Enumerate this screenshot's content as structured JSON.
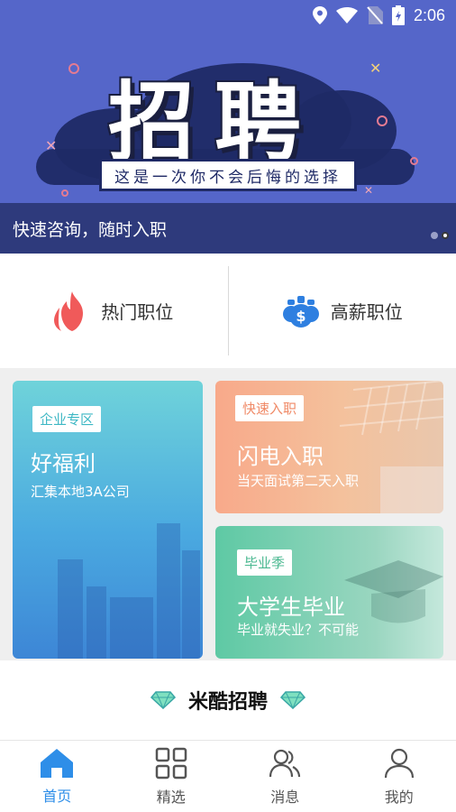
{
  "status_bar": {
    "time": "2:06"
  },
  "banner": {
    "title": "招聘",
    "subtitle": "这是一次你不会后悔的选择",
    "caption": "快速咨询，随时入职",
    "page_count": 2,
    "active_page": 2
  },
  "categories": [
    {
      "label": "热门职位",
      "icon": "flame-icon"
    },
    {
      "label": "高薪职位",
      "icon": "money-bag-icon"
    }
  ],
  "cards": {
    "enterprise": {
      "tag": "企业专区",
      "title": "好福利",
      "desc": "汇集本地3A公司"
    },
    "fast": {
      "tag": "快速入职",
      "title": "闪电入职",
      "desc": "当天面试第二天入职"
    },
    "graduate": {
      "tag": "毕业季",
      "title": "大学生毕业",
      "desc": "毕业就失业？不可能"
    }
  },
  "brand": {
    "name": "米酷招聘"
  },
  "colors": {
    "primary": "#2e8ee8",
    "banner": "#5566c9",
    "flame": "#f05a5a"
  },
  "nav": [
    {
      "label": "首页",
      "icon": "home-icon",
      "active": true
    },
    {
      "label": "精选",
      "icon": "grid-icon",
      "active": false
    },
    {
      "label": "消息",
      "icon": "contacts-icon",
      "active": false
    },
    {
      "label": "我的",
      "icon": "user-icon",
      "active": false
    }
  ]
}
